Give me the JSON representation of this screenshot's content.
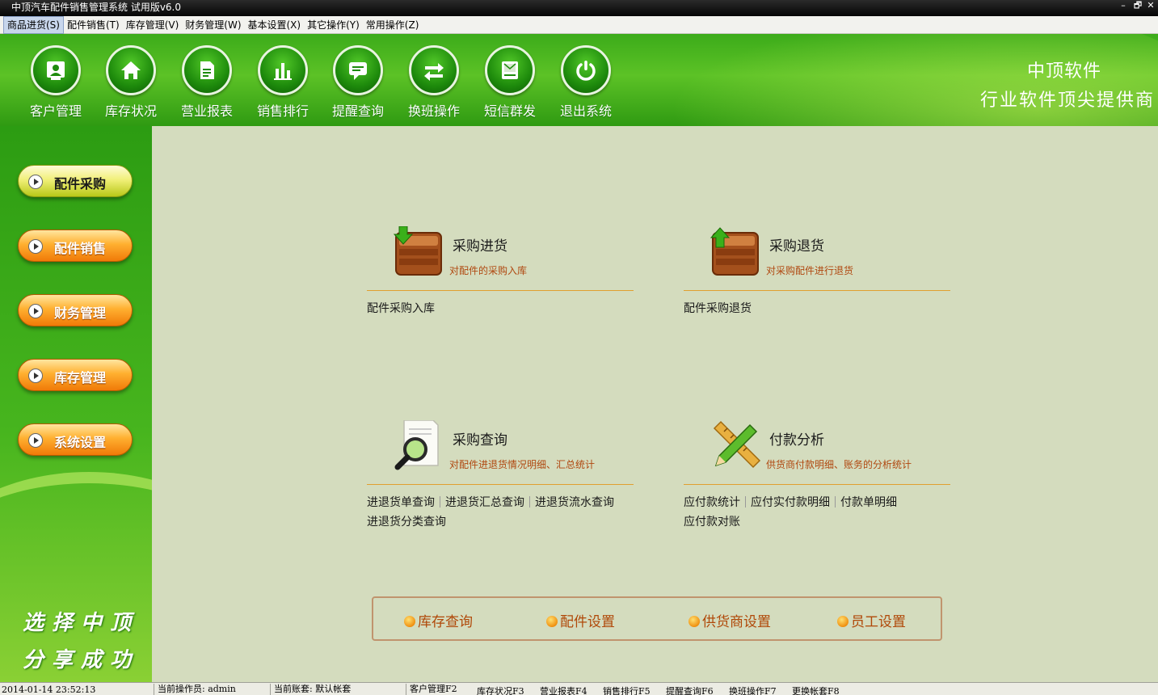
{
  "window": {
    "title": "中顶汽车配件销售管理系统 试用版v6.0",
    "minimize_glyph": "–",
    "restore_glyph": "🗗",
    "close_glyph": "✕"
  },
  "menu": [
    {
      "label": "商品进货(S)"
    },
    {
      "label": "配件销售(T)"
    },
    {
      "label": "库存管理(V)"
    },
    {
      "label": "财务管理(W)"
    },
    {
      "label": "基本设置(X)"
    },
    {
      "label": "其它操作(Y)"
    },
    {
      "label": "常用操作(Z)"
    }
  ],
  "toolbar": [
    {
      "label": "客户管理",
      "icon": "customer-icon"
    },
    {
      "label": "库存状况",
      "icon": "home-icon"
    },
    {
      "label": "营业报表",
      "icon": "report-icon"
    },
    {
      "label": "销售排行",
      "icon": "bar-chart-icon"
    },
    {
      "label": "提醒查询",
      "icon": "message-icon"
    },
    {
      "label": "换班操作",
      "icon": "swap-icon"
    },
    {
      "label": "短信群发",
      "icon": "sms-icon"
    },
    {
      "label": "退出系统",
      "icon": "power-icon"
    }
  ],
  "brand": {
    "line1": "中顶软件",
    "line2": "行业软件顶尖提供商"
  },
  "sidebar": {
    "items": [
      {
        "label": "配件采购",
        "style": "yellow"
      },
      {
        "label": "配件销售",
        "style": "orange"
      },
      {
        "label": "财务管理",
        "style": "orange"
      },
      {
        "label": "库存管理",
        "style": "orange"
      },
      {
        "label": "系统设置",
        "style": "orange"
      }
    ],
    "slogan_line1": "选择中顶",
    "slogan_line2": "分享成功"
  },
  "cards": [
    {
      "title": "采购进货",
      "desc": "对配件的采购入库",
      "icon": "box-in-icon",
      "links": [
        "配件采购入库"
      ]
    },
    {
      "title": "采购退货",
      "desc": "对采购配件进行退货",
      "icon": "box-out-icon",
      "links": [
        "配件采购退货"
      ]
    },
    {
      "title": "采购查询",
      "desc": "对配件进退货情况明细、汇总统计",
      "icon": "magnifier-doc-icon",
      "links": [
        "进退货单查询",
        "进退货汇总查询",
        "进退货流水查询",
        "进退货分类查询"
      ]
    },
    {
      "title": "付款分析",
      "desc": "供货商付款明细、账务的分析统计",
      "icon": "pencil-ruler-icon",
      "links": [
        "应付款统计",
        "应付实付款明细",
        "付款单明细",
        "应付款对账"
      ]
    }
  ],
  "quickbar": [
    {
      "label": "库存查询"
    },
    {
      "label": "配件设置"
    },
    {
      "label": "供货商设置"
    },
    {
      "label": "员工设置"
    }
  ],
  "status": {
    "datetime": "2014-01-14 23:52:13",
    "operator": "当前操作员: admin",
    "account": "当前账套: 默认帐套",
    "shortcuts": [
      "客户管理F2",
      "库存状况F3",
      "营业报表F4",
      "销售排行F5",
      "提醒查询F6",
      "换班操作F7",
      "更换帐套F8"
    ]
  },
  "colors": {
    "header_green": "#3cab1a",
    "content_bg": "#d4dcbe",
    "desc_orange": "#b04810",
    "divider": "#e0a030"
  }
}
